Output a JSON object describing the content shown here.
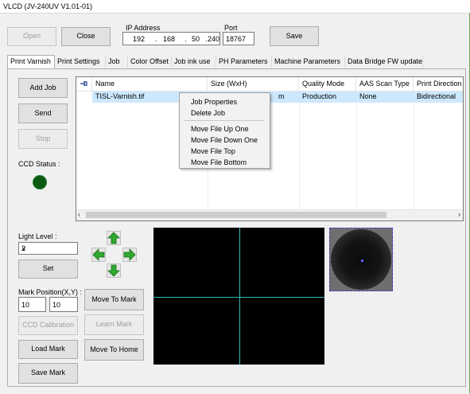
{
  "window": {
    "title": "VLCD (JV-240UV V1.01-01)"
  },
  "top": {
    "open": "Open",
    "close": "Close",
    "ip_label": "IP Address",
    "ip": [
      "192",
      ".",
      "168",
      ".",
      "50",
      ".",
      "240"
    ],
    "port_label": "Port",
    "port_value": "18767",
    "save": "Save"
  },
  "tabs": [
    "Print Varnish",
    "Print Settings",
    "Job",
    "Color Offset",
    "Job ink use",
    "PH Parameters",
    "Machine Parameters",
    "Data Bridge FW update"
  ],
  "left": {
    "add_job": "Add Job",
    "send": "Send",
    "stop": "Stop",
    "ccd_status": "CCD Status :"
  },
  "list": {
    "pin_icon": "pin-icon",
    "headers": [
      "Name",
      "Size (WxH)",
      "Quality Mode",
      "AAS Scan Type",
      "Print Direction"
    ],
    "rows": [
      {
        "name": "TISL-Varnish.tif",
        "size": "m",
        "quality": "Production",
        "aas": "None",
        "direction": "Bidirectional"
      }
    ]
  },
  "context_menu": [
    "Job Properties",
    "Delete Job",
    "Move File Up One",
    "Move File Down One",
    "Move File Top",
    "Move File Bottom"
  ],
  "bottom": {
    "light_level_label": "Light Level :",
    "light_level_value": "2",
    "set": "Set",
    "mark_position_label": "Mark Position(X,Y) :",
    "mark_x": "10",
    "mark_y": "10",
    "ccd_calibration": "CCD Calibration",
    "load_mark": "Load Mark",
    "save_mark": "Save Mark",
    "move_to_mark": "Move To Mark",
    "learn_mark": "Learn Mark",
    "move_to_home": "Move To Home"
  },
  "colors": {
    "led": "#0a5a12",
    "crosshair": "#2fb9b9",
    "arrows": "#2fa82f",
    "selection": "#cce8ff"
  }
}
